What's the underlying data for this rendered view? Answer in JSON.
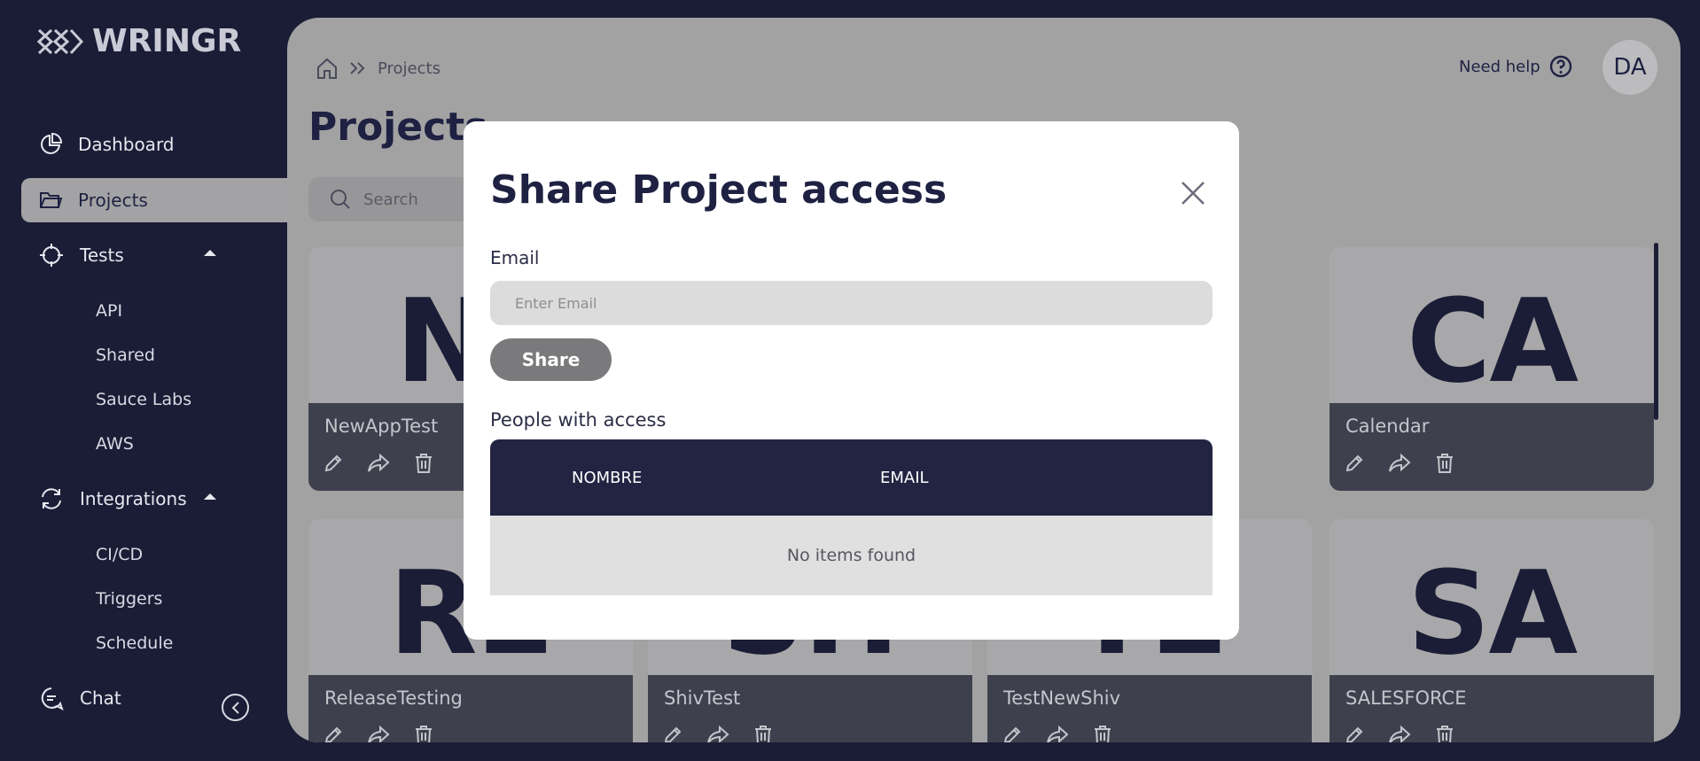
{
  "app": {
    "logo_text": "WRINGR"
  },
  "sidebar": {
    "items": [
      {
        "label": "Dashboard",
        "icon": "pie-chart-icon"
      },
      {
        "label": "Projects",
        "icon": "folder-icon"
      },
      {
        "label": "Tests",
        "icon": "crosshair-icon"
      },
      {
        "label": "Integrations",
        "icon": "refresh-icon"
      },
      {
        "label": "Chat",
        "icon": "chat-icon"
      }
    ],
    "tests_sub": [
      "API",
      "Shared",
      "Sauce Labs",
      "AWS"
    ],
    "integrations_sub": [
      "CI/CD",
      "Triggers",
      "Schedule"
    ]
  },
  "header": {
    "breadcrumb": "Projects",
    "title": "Projects",
    "help_label": "Need help",
    "avatar_initials": "DA",
    "search_placeholder": "Search"
  },
  "projects": [
    {
      "initials": "N",
      "name": "NewAppTest"
    },
    {
      "initials": "CA",
      "name": "Calendar"
    },
    {
      "initials": "RE",
      "name": "ReleaseTesting"
    },
    {
      "initials": "SH",
      "name": "ShivTest"
    },
    {
      "initials": "TE",
      "name": "TestNewShiv"
    },
    {
      "initials": "SA",
      "name": "SALESFORCE"
    }
  ],
  "modal": {
    "title": "Share Project access",
    "email_label": "Email",
    "email_placeholder": "Enter Email",
    "email_value": "",
    "share_label": "Share",
    "access_label": "People with access",
    "columns": [
      "NOMBRE",
      "EMAIL"
    ],
    "empty_text": "No items found"
  }
}
